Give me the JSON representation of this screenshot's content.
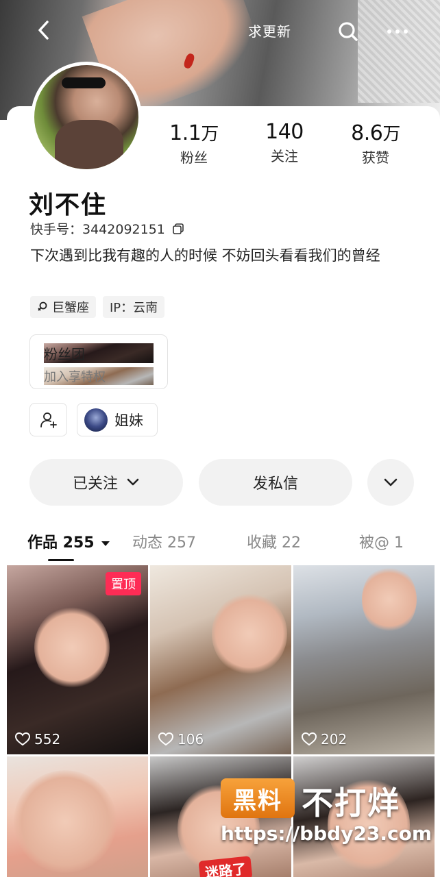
{
  "topbar": {
    "update_label": "求更新"
  },
  "profile": {
    "name": "刘不住",
    "kuaishou_id": "快手号：3442092151",
    "bio": "下次遇到比我有趣的人的时候 不妨回头看看我们的曾经",
    "tags": [
      "巨蟹座",
      "IP：云南"
    ]
  },
  "stats": [
    {
      "num": "1.1",
      "unit": "万",
      "label": "粉丝"
    },
    {
      "num": "140",
      "unit": "",
      "label": "关注"
    },
    {
      "num": "8.6",
      "unit": "万",
      "label": "获赞"
    }
  ],
  "fan_club": {
    "title": "粉丝团",
    "subtitle": "加入享特权"
  },
  "sister_label": "姐妹",
  "actions": {
    "followed": "已关注",
    "message": "发私信"
  },
  "tabs": [
    {
      "label": "作品 255"
    },
    {
      "label": "动态 257"
    },
    {
      "label": "收藏 22"
    },
    {
      "label": "被@ 1"
    }
  ],
  "grid": [
    {
      "likes": "552",
      "pinned_label": "置顶"
    },
    {
      "likes": "106"
    },
    {
      "likes": "202"
    },
    {
      "overlay": "迷路了"
    },
    {},
    {}
  ],
  "watermark": {
    "logo": "黑料",
    "text": "不打烊",
    "url": "https://bbdy23.com"
  }
}
